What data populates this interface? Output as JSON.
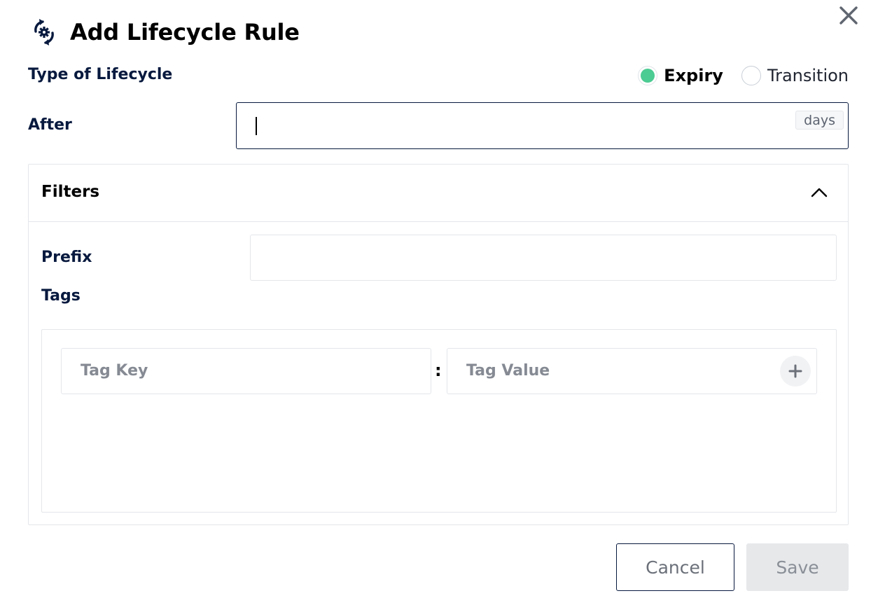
{
  "dialog": {
    "title": "Add Lifecycle Rule",
    "title_icon": "lifecycle-refresh-gear-icon",
    "close_icon": "close-x-icon"
  },
  "lifecycle_type": {
    "label": "Type of Lifecycle",
    "options": [
      {
        "label": "Expiry",
        "selected": true
      },
      {
        "label": "Transition",
        "selected": false
      }
    ],
    "selected_color": "#4ccb92"
  },
  "after": {
    "label": "After",
    "value": "",
    "unit": "days"
  },
  "filters": {
    "title": "Filters",
    "collapse_icon": "chevron-up-icon",
    "prefix": {
      "label": "Prefix",
      "value": ""
    },
    "tags": {
      "label": "Tags",
      "key_placeholder": "Tag Key",
      "separator": ":",
      "value_placeholder": "Tag Value",
      "add_icon": "plus-icon"
    }
  },
  "actions": {
    "cancel_label": "Cancel",
    "save_label": "Save"
  },
  "colors": {
    "label_navy": "#07193e",
    "border": "#e3e6ea"
  }
}
